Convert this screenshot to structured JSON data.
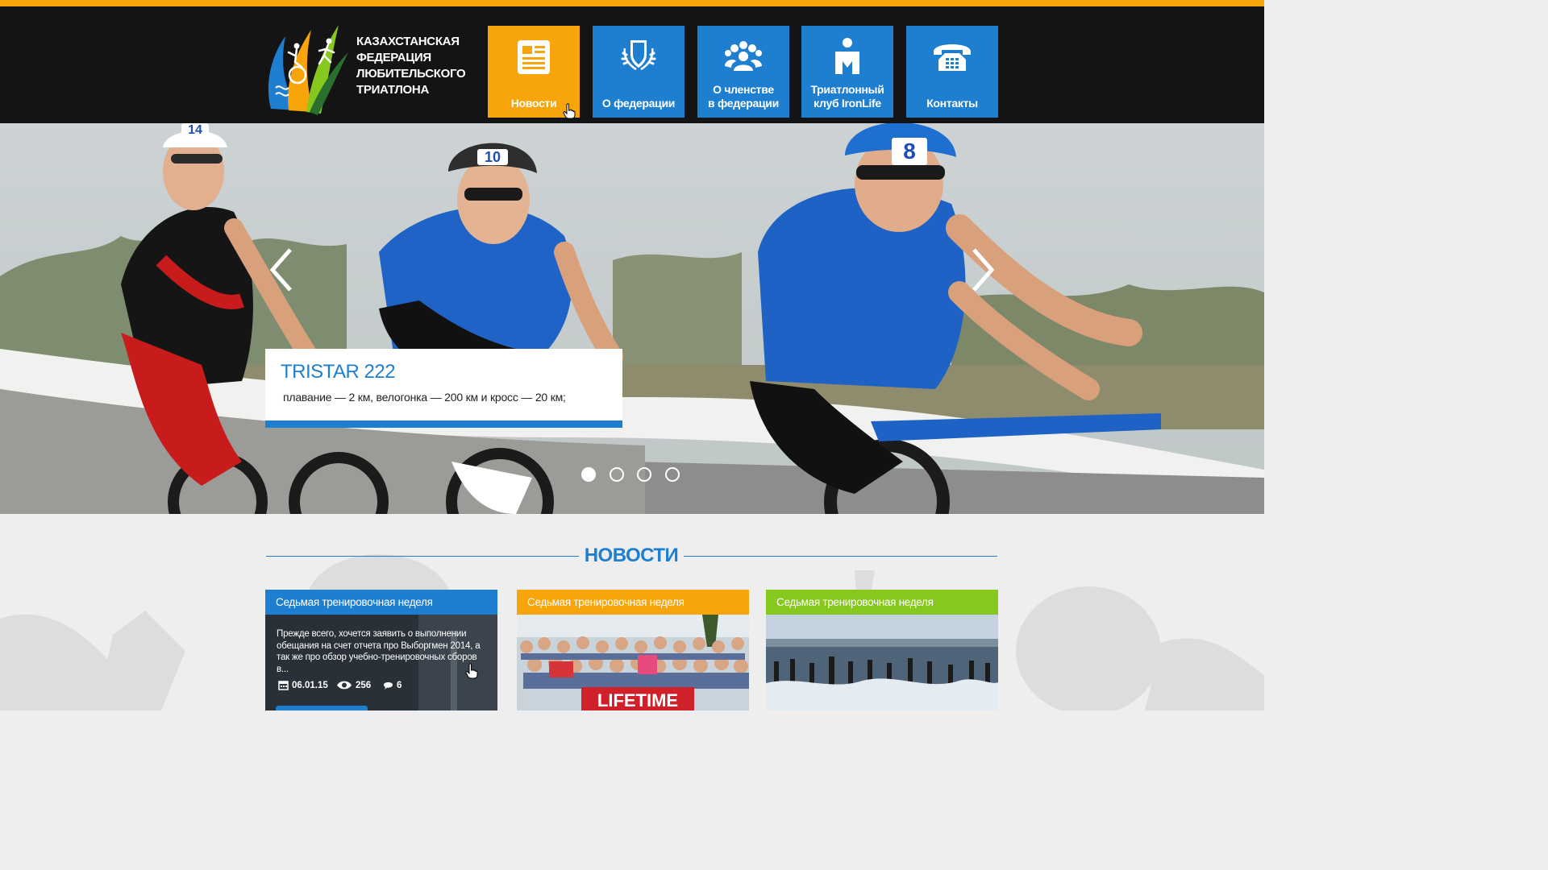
{
  "header": {
    "logo_lines": [
      "КАЗАХСТАНСКАЯ",
      "ФЕДЕРАЦИЯ",
      "ЛЮБИТЕЛЬСКОГО",
      "ТРИАТЛОНА"
    ],
    "nav": [
      {
        "label": "Новости",
        "icon": "newspaper-icon",
        "color": "#f7a50a",
        "active": true
      },
      {
        "label": "О федерации",
        "icon": "shield-laurel-icon",
        "color": "#1e7fd1"
      },
      {
        "label": "О членстве\nв федерации",
        "icon": "group-icon",
        "color": "#1e7fd1"
      },
      {
        "label": "Триатлонный\nклуб IronLife",
        "icon": "ironman-icon",
        "color": "#1e7fd1"
      },
      {
        "label": "Контакты",
        "icon": "telephone-icon",
        "color": "#1e7fd1"
      }
    ]
  },
  "hero": {
    "bib_numbers": [
      "14",
      "10",
      "8"
    ],
    "caption_title": "TRISTAR 222",
    "caption_text": "плавание — 2 км, велогонка — 200 км и кросс — 20 км;",
    "slide_count": 4,
    "active_slide": 1
  },
  "news": {
    "section_title": "НОВОСТИ",
    "cards": [
      {
        "title": "Седьмая тренировочная неделя",
        "color": "#1e7fd1",
        "text": "Прежде всего, хочется заявить о выполнении обещания на счет отчета про Выборгмен 2014, а так же про обзор учебно-тренировочных сборов в...",
        "date": "06.01.15",
        "views": "256",
        "comments": "6"
      },
      {
        "title": "Седьмая тренировочная неделя",
        "color": "#f7a50a",
        "banner_text": "LIFETIME"
      },
      {
        "title": "Седьмая тренировочная неделя",
        "color": "#86c81e"
      }
    ]
  },
  "colors": {
    "accent": "#f7a50a",
    "brand": "#1e7fd1",
    "green": "#86c81e",
    "header": "#141414"
  }
}
